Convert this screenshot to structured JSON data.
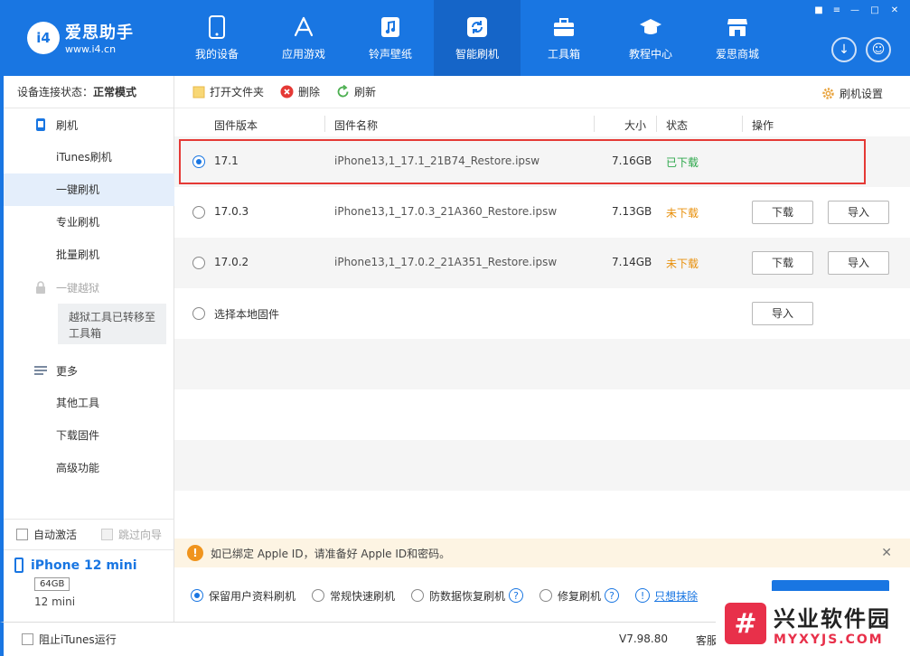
{
  "app": {
    "logo_badge": "i4",
    "name": "爱思助手",
    "url": "www.i4.cn"
  },
  "nav": [
    {
      "label": "我的设备",
      "icon": "phone-icon"
    },
    {
      "label": "应用游戏",
      "icon": "app-store-icon"
    },
    {
      "label": "铃声壁纸",
      "icon": "music-icon"
    },
    {
      "label": "智能刷机",
      "icon": "refresh-icon",
      "active": true
    },
    {
      "label": "工具箱",
      "icon": "toolbox-icon"
    },
    {
      "label": "教程中心",
      "icon": "graduation-cap-icon"
    },
    {
      "label": "爱思商城",
      "icon": "store-icon"
    }
  ],
  "sidebar": {
    "status_label": "设备连接状态：",
    "status_value": "正常模式",
    "group_flash": "刷机",
    "items_flash": [
      "iTunes刷机",
      "一键刷机",
      "专业刷机",
      "批量刷机"
    ],
    "group_jailbreak": "一键越狱",
    "jailbreak_note": "越狱工具已转移至工具箱",
    "group_more": "更多",
    "items_more": [
      "其他工具",
      "下载固件",
      "高级功能"
    ],
    "auto_activate": "自动激活",
    "skip_guide": "跳过向导"
  },
  "device": {
    "name": "iPhone 12 mini",
    "capacity": "64GB",
    "ios": "12 mini"
  },
  "toolbar": {
    "open_folder": "打开文件夹",
    "delete": "删除",
    "refresh": "刷新",
    "settings": "刷机设置"
  },
  "table": {
    "headers": {
      "version": "固件版本",
      "name": "固件名称",
      "size": "大小",
      "status": "状态",
      "action": "操作"
    },
    "rows": [
      {
        "version": "17.1",
        "name": "iPhone13,1_17.1_21B74_Restore.ipsw",
        "size": "7.16GB",
        "status": "已下载",
        "selected": true
      },
      {
        "version": "17.0.3",
        "name": "iPhone13,1_17.0.3_21A360_Restore.ipsw",
        "size": "7.13GB",
        "status": "未下载",
        "download": "下载",
        "import": "导入"
      },
      {
        "version": "17.0.2",
        "name": "iPhone13,1_17.0.2_21A351_Restore.ipsw",
        "size": "7.14GB",
        "status": "未下载",
        "download": "下载",
        "import": "导入"
      },
      {
        "version": "选择本地固件",
        "import": "导入"
      }
    ]
  },
  "notice": {
    "text": "如已绑定 Apple ID，请准备好 Apple ID和密码。"
  },
  "options": {
    "keep_data": "保留用户资料刷机",
    "normal_fast": "常规快速刷机",
    "anti_recovery": "防数据恢复刷机",
    "repair": "修复刷机",
    "link": "只想抹除"
  },
  "statusbar": {
    "block_itunes": "阻止iTunes运行",
    "version": "V7.98.80",
    "service": "客服"
  },
  "watermark": {
    "logo": "#",
    "cn": "兴业软件园",
    "en": "MYXYJS.COM"
  },
  "colors": {
    "primary": "#1976e2",
    "downloaded": "#2ea84c",
    "not_downloaded": "#e8900c",
    "highlight": "#e53935"
  }
}
